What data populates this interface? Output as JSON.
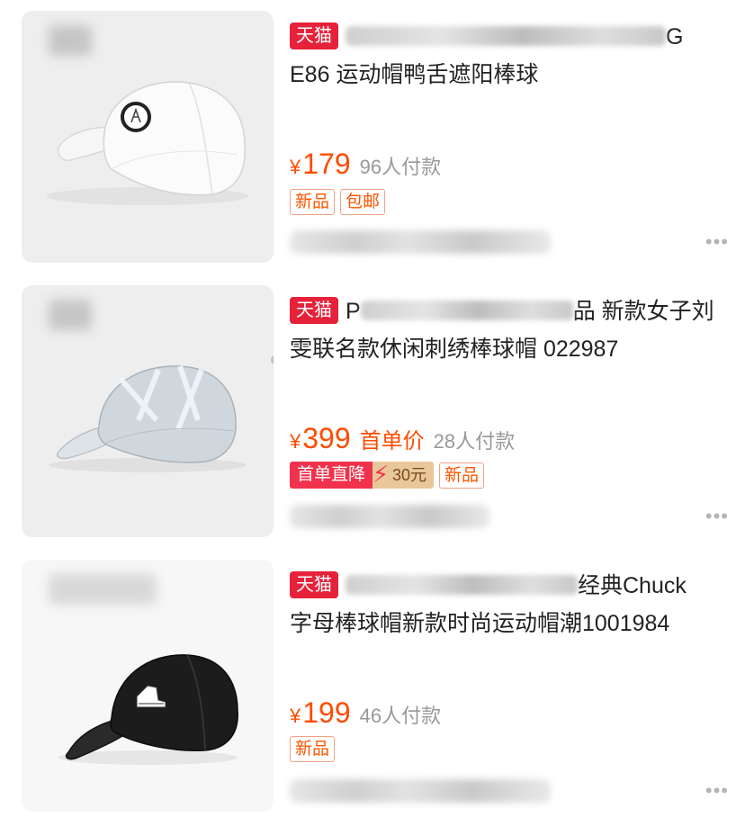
{
  "products": [
    {
      "platform_badge": "天猫",
      "title_visible_end": "G",
      "title_line2": "E86 运动帽鸭舌遮阳棒球",
      "currency": "¥",
      "price": "179",
      "buyers": "96人付款",
      "tags": [
        "新品",
        "包邮"
      ],
      "more": "•••"
    },
    {
      "platform_badge": "天猫",
      "title_visible_start": "P",
      "title_visible_mid": "品 新款女子刘",
      "title_line2": "雯联名款休闲刺绣棒球帽 022987",
      "currency": "¥",
      "price": "399",
      "price_note": "首单价",
      "buyers": "28人付款",
      "promo_label": "首单直降",
      "promo_value": "30元",
      "tags": [
        "新品"
      ],
      "more": "•••"
    },
    {
      "platform_badge": "天猫",
      "title_visible_end": "经典Chuck",
      "title_line2": "字母棒球帽新款时尚运动帽潮1001984",
      "currency": "¥",
      "price": "199",
      "buyers": "46人付款",
      "tags": [
        "新品"
      ],
      "more": "•••"
    }
  ],
  "colors": {
    "price_orange": "#ff4b00",
    "tmall_red": "#e6223a",
    "tag_border": "#f2a187",
    "thumb_bg": "#eeeeee"
  }
}
